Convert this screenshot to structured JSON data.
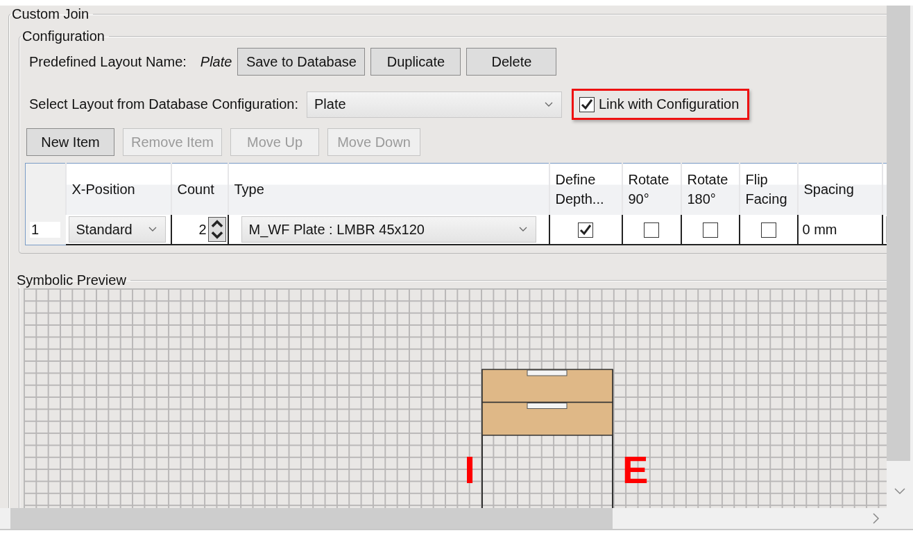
{
  "custom_join": {
    "title": "Custom Join"
  },
  "configuration": {
    "title": "Configuration",
    "layout_name_label": "Predefined Layout Name:",
    "layout_name": "Plate",
    "layout_buttons": [
      {
        "label": "Save to Database",
        "disabled": false
      },
      {
        "label": "Duplicate",
        "disabled": false
      },
      {
        "label": "Delete",
        "disabled": false
      }
    ],
    "select_label": "Select Layout from Database Configuration:",
    "select_value": "Plate",
    "link_checkbox": {
      "label": "Link with Configuration",
      "checked": true,
      "highlighted": true
    },
    "item_buttons": [
      {
        "label": "New Item",
        "disabled": false
      },
      {
        "label": "Remove Item",
        "disabled": true
      },
      {
        "label": "Move Up",
        "disabled": true
      },
      {
        "label": "Move Down",
        "disabled": true
      }
    ],
    "table": {
      "columns": [
        "X-Position",
        "Count",
        "Type",
        "Define Depth...",
        "Rotate 90°",
        "Rotate 180°",
        "Flip Facing",
        "Spacing"
      ],
      "rows": [
        {
          "number": "1",
          "x_position": "Standard",
          "count": "2",
          "type": "M_WF Plate : LMBR 45x120",
          "define_depth": true,
          "rotate_90": false,
          "rotate_180": false,
          "flip_facing": false,
          "spacing": "0 mm"
        }
      ]
    }
  },
  "symbolic_preview": {
    "title": "Symbolic Preview",
    "plates": [
      {
        "kind": "plate"
      },
      {
        "kind": "plate"
      }
    ],
    "interior_label": "I",
    "exterior_label": "E"
  }
}
